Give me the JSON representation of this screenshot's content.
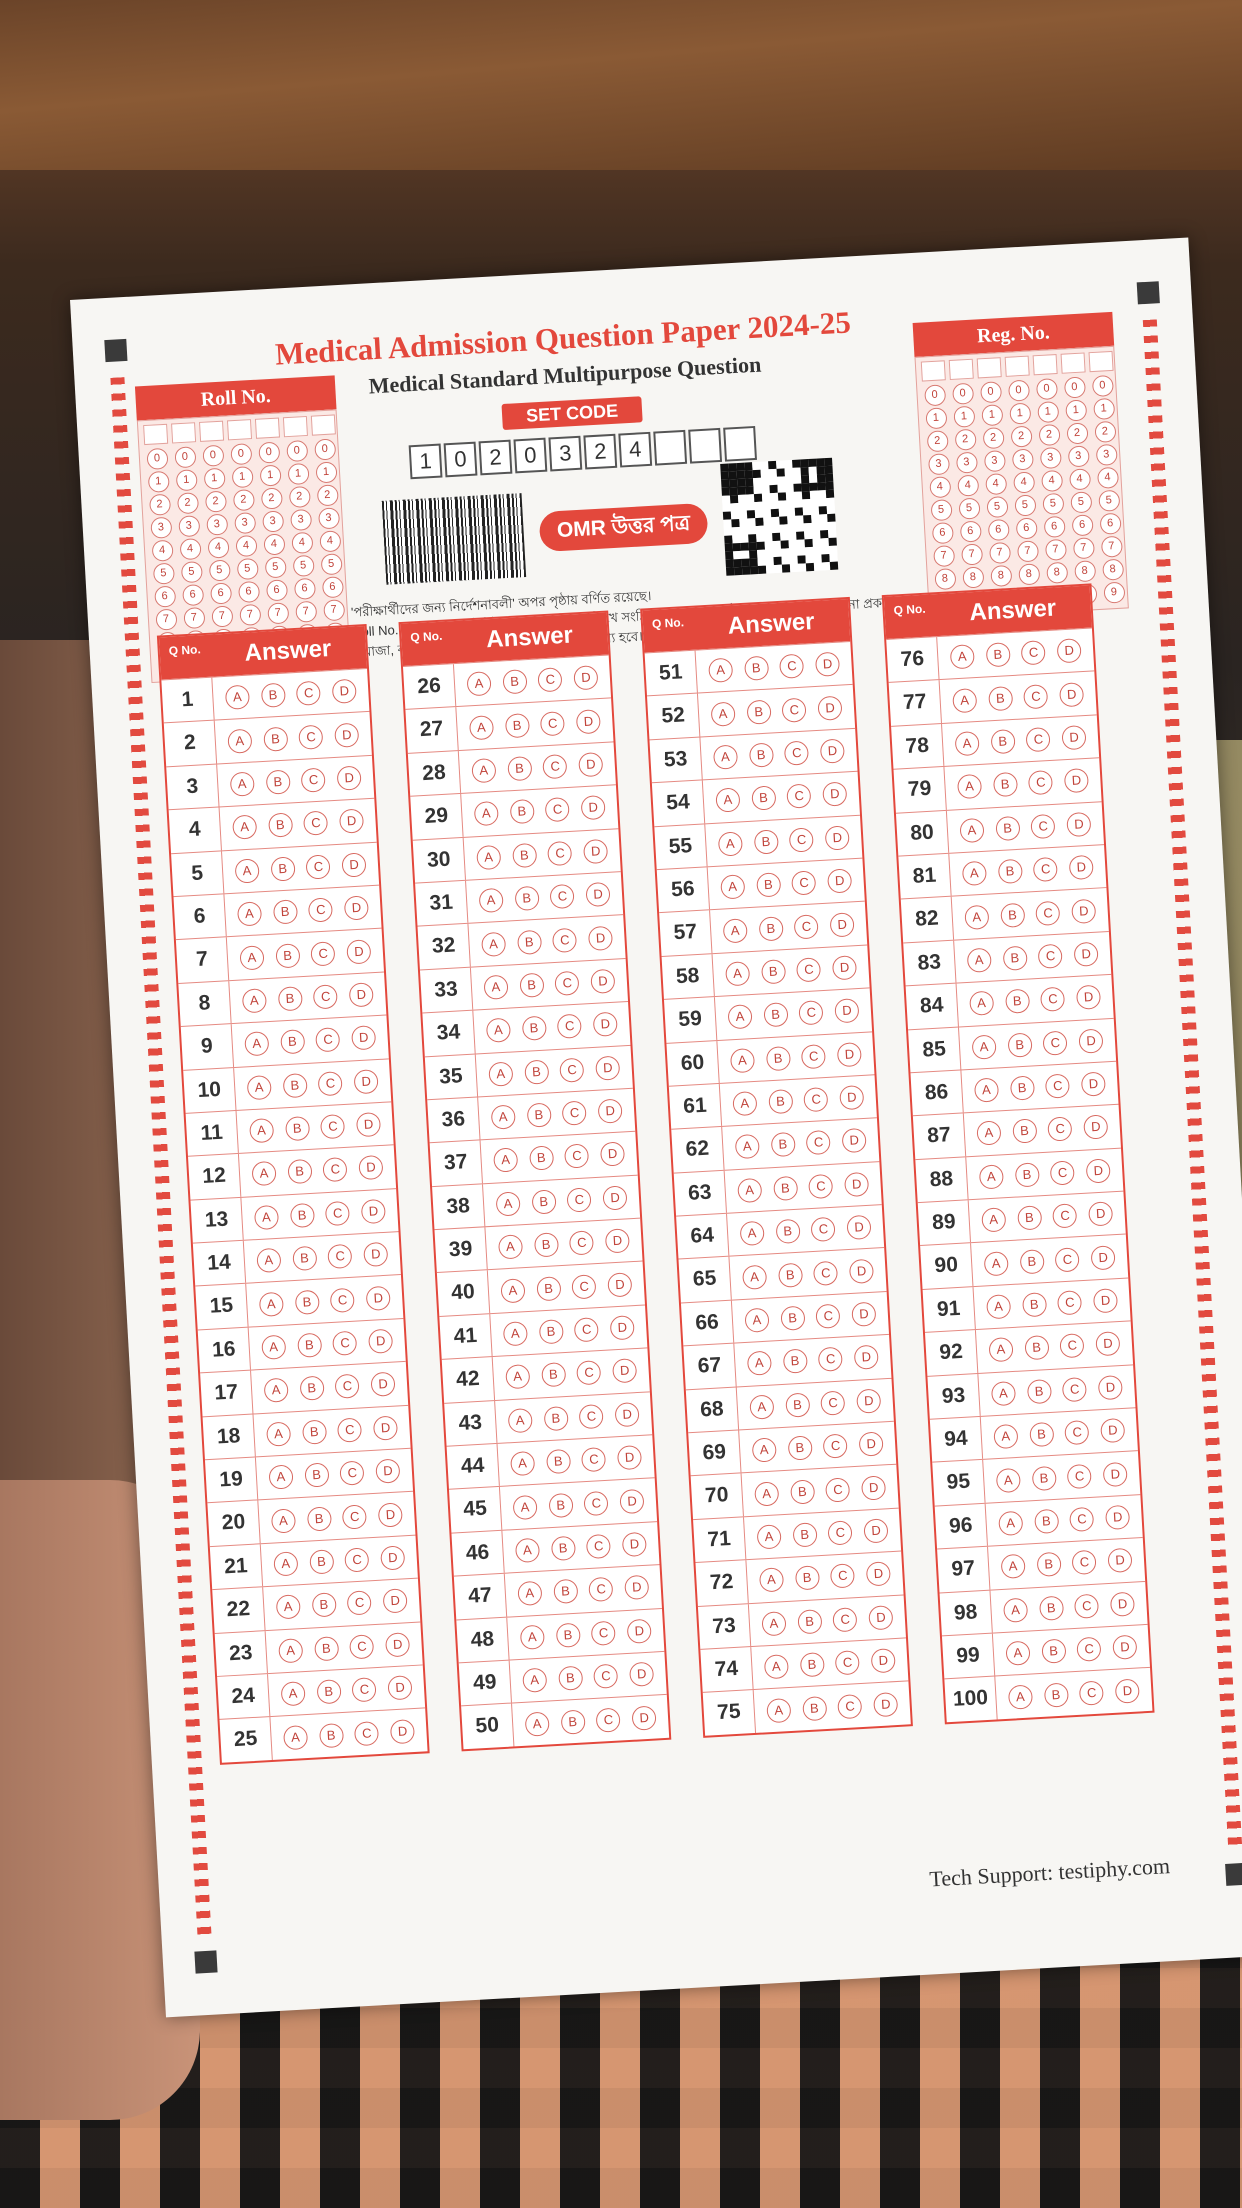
{
  "sheet": {
    "title": "Medical Admission Question Paper 2024-25",
    "subtitle": "Medical Standard Multipurpose Question",
    "set_code_label": "SET CODE",
    "set_code_digits": [
      "1",
      "0",
      "2",
      "0",
      "3",
      "2",
      "4",
      "",
      "",
      ""
    ],
    "omr_label": "OMR উত্তর পত্র",
    "note_1": "• 'পরীক্ষার্থীদের জন্য নির্দেশনাবলী' অপর পৃষ্ঠায় বর্ণিত রয়েছে।",
    "note_2": "• Roll No. ও Reg. No. নির্দিষ্ট স্থানে ইংরেজিতে লিখে সংশ্লিষ্ট বৃত্তগুলো ভরাট করতে হবে এবং কোনো প্রকার ঘষামাজা, কাটাকাটি করলে উত্তরপত্র বাতিল বলে গণ্য হবে।",
    "roll_label": "Roll No.",
    "reg_label": "Reg. No.",
    "q_no_label": "Q No.",
    "answer_label": "Answer",
    "options": [
      "A",
      "B",
      "C",
      "D"
    ],
    "digits": [
      "0",
      "1",
      "2",
      "3",
      "4",
      "5",
      "6",
      "7",
      "8",
      "9"
    ],
    "support": "Tech Support: testiphy.com"
  },
  "colors": {
    "accent": "#e3483c",
    "paper": "#f7f6f3"
  }
}
